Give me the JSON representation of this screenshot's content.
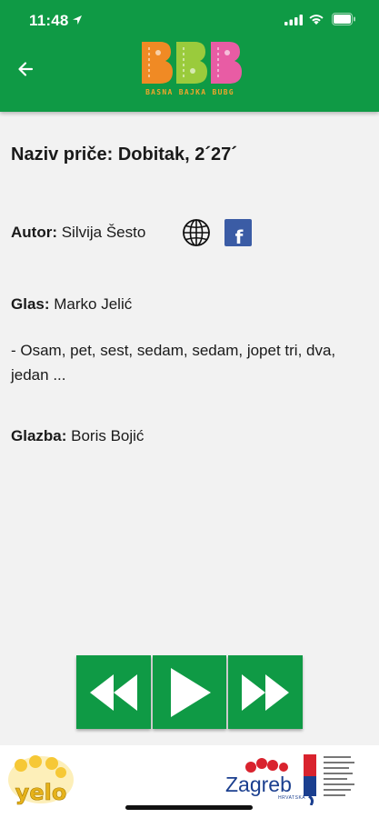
{
  "status_bar": {
    "time": "11:48"
  },
  "header": {
    "logo_text": "BASNA BAJKA BUBG",
    "back_icon": "arrow-left-icon"
  },
  "story": {
    "title": "Naziv priče: Dobitak, 2´27´",
    "author_label": "Autor:",
    "author_value": " Silvija Šesto",
    "voice_label": "Glas:",
    "voice_value": " Marko  Jelić",
    "lyrics": "- Osam, pet, sest, sedam, sedam, jopet tri, dva, jedan ...",
    "music_label": "Glazba:",
    "music_value": " Boris Bojić"
  },
  "social": {
    "facebook_letter": "f"
  },
  "player": {
    "rewind_icon": "rewind-icon",
    "play_icon": "play-icon",
    "forward_icon": "fast-forward-icon"
  },
  "footer": {
    "yelo_text": "yelo",
    "zagreb_text": "Zagreb",
    "zagreb_sub": "HRVATSKA"
  },
  "colors": {
    "brand_green": "#0f9a45",
    "facebook_blue": "#3b5ca5"
  }
}
